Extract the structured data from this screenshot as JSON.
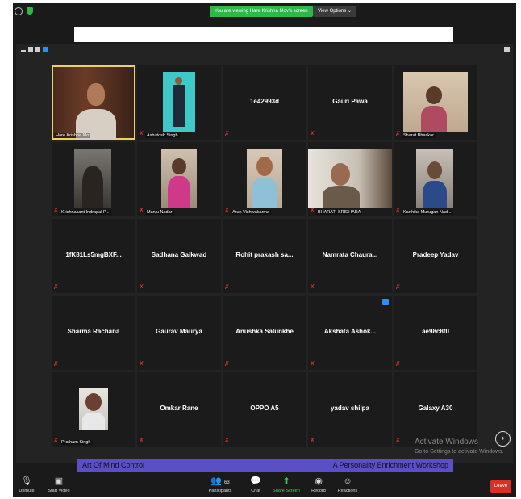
{
  "topbar": {
    "viewing_banner": "You are viewing Hare Krishna Mov's screen",
    "view_options": "View Options ⌄"
  },
  "tiles": [
    {
      "name": "Hare Krishna Mo",
      "label": "Hare Krishna Mo",
      "video": true,
      "active": true
    },
    {
      "name": "Ashutosh Singh",
      "label": "Ashutosh Singh",
      "video": true
    },
    {
      "name": "1e42993d",
      "label": "",
      "video": false
    },
    {
      "name": "Gauri Pawa",
      "label": "",
      "video": false
    },
    {
      "name": "Sharat Bhaskar",
      "label": "Sharat Bhaskar",
      "video": true
    },
    {
      "name": "Krishnakant Indrapal P...",
      "label": "Krishnakant Indrapal P...",
      "video": true
    },
    {
      "name": "Manju Nadar",
      "label": "Manju Nadar",
      "video": true
    },
    {
      "name": "Arun Vishwakarma",
      "label": "Arun Vishwakarma",
      "video": true
    },
    {
      "name": "BHARATI SRIDHARA",
      "label": "BHARATI SRIDHARA",
      "video": true
    },
    {
      "name": "Karthika Murugan Nad...",
      "label": "Karthika Murugan Nad...",
      "video": true
    },
    {
      "name": "1fK81Ls5mgBXF...",
      "label": "",
      "video": false
    },
    {
      "name": "Sadhana Gaikwad",
      "label": "",
      "video": false
    },
    {
      "name": "Rohit prakash sa...",
      "label": "",
      "video": false
    },
    {
      "name": "Namrata  Chaura...",
      "label": "",
      "video": false
    },
    {
      "name": "Pradeep Yadav",
      "label": "",
      "video": false
    },
    {
      "name": "Sharma Rachana",
      "label": "",
      "video": false
    },
    {
      "name": "Gaurav Maurya",
      "label": "",
      "video": false
    },
    {
      "name": "Anushka Salunkhe",
      "label": "",
      "video": false
    },
    {
      "name": "Akshata  Ashok...",
      "label": "",
      "video": false,
      "notif": true
    },
    {
      "name": "ae98c8f0",
      "label": "",
      "video": false
    },
    {
      "name": "Pratham Singh",
      "label": "Pratham Singh",
      "video": true
    },
    {
      "name": "Omkar Rane",
      "label": "",
      "video": false
    },
    {
      "name": "OPPO A5",
      "label": "",
      "video": false
    },
    {
      "name": "yadav shilpa",
      "label": "",
      "video": false
    },
    {
      "name": "Galaxy A30",
      "label": "",
      "video": false
    }
  ],
  "watermark": {
    "line1": "Activate Windows",
    "line2": "Go to Settings to activate Windows."
  },
  "shared_screen": {
    "left_text": "Art Of Mind Control",
    "right_text": "A Personality Enrichment Workshop"
  },
  "toolbar": {
    "unmute": "Unmute",
    "start_video": "Start Video",
    "participants": "Participants",
    "participants_count": "63",
    "chat": "Chat",
    "share_screen": "Share Screen",
    "record": "Record",
    "reactions": "Reactions",
    "leave": "Leave"
  },
  "colors": {
    "banner_green": "#2fb84a",
    "active_speaker": "#e6d36a",
    "muted_red": "#e0312f",
    "leave_red": "#d93025",
    "share_screen_green": "#3ad35a"
  }
}
